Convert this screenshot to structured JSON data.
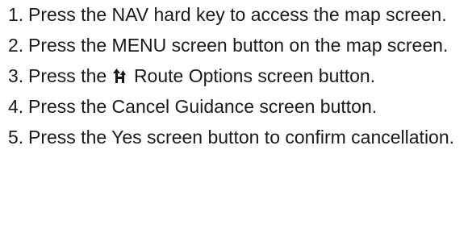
{
  "steps": [
    {
      "num": "1.",
      "text": "Press the NAV hard key to access the map screen."
    },
    {
      "num": "2.",
      "text": "Press the MENU screen button on the map screen."
    },
    {
      "num": "3.",
      "pre": "Press the",
      "icon": "route-options-icon",
      "post": "Route Options screen button."
    },
    {
      "num": "4.",
      "text": "Press the Cancel Guidance screen button."
    },
    {
      "num": "5.",
      "text": "Press the Yes screen button to confirm cancellation."
    }
  ]
}
